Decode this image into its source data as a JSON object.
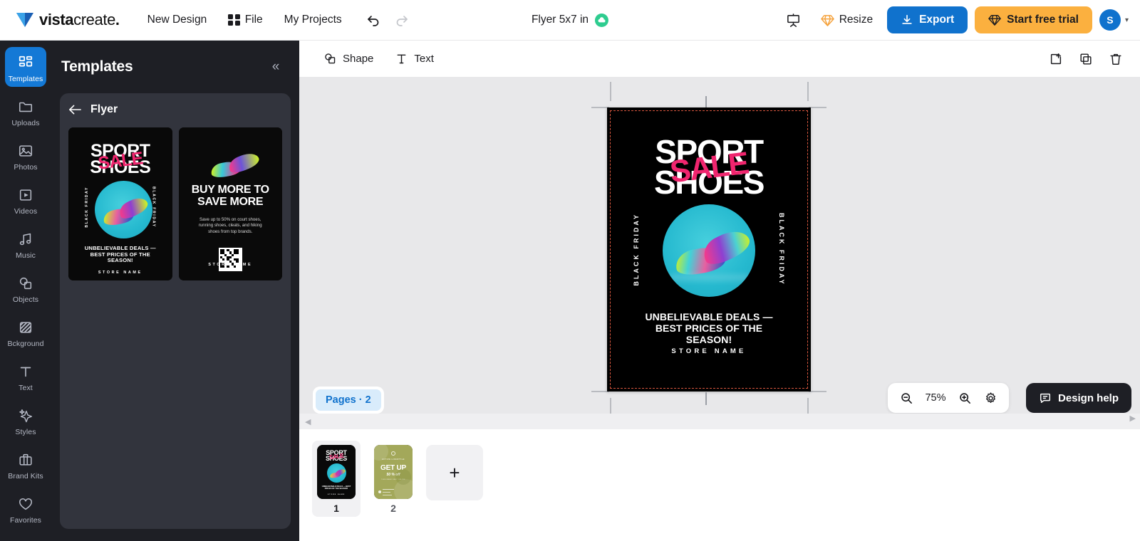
{
  "brand": {
    "logo_text_bold": "vista",
    "logo_text_thin": "create",
    "logo_dot": "."
  },
  "topbar": {
    "new_design": "New Design",
    "file": "File",
    "my_projects": "My Projects",
    "undo_icon": "undo-icon",
    "redo_icon": "redo-icon",
    "doc_title": "Flyer 5x7 in",
    "saved_icon": "cloud-saved-icon",
    "present_icon": "present-icon",
    "resize": "Resize",
    "resize_icon": "premium-diamond-icon",
    "export": "Export",
    "export_icon": "download-icon",
    "trial": "Start free trial",
    "trial_icon": "premium-diamond-icon",
    "avatar_initial": "S",
    "avatar_caret": "▾"
  },
  "rail": {
    "items": [
      {
        "label": "Templates",
        "icon": "templates-icon",
        "active": true
      },
      {
        "label": "Uploads",
        "icon": "folder-icon",
        "active": false
      },
      {
        "label": "Photos",
        "icon": "photo-icon",
        "active": false
      },
      {
        "label": "Videos",
        "icon": "video-icon",
        "active": false
      },
      {
        "label": "Music",
        "icon": "music-icon",
        "active": false
      },
      {
        "label": "Objects",
        "icon": "objects-icon",
        "active": false
      },
      {
        "label": "Bckground",
        "icon": "background-icon",
        "active": false
      },
      {
        "label": "Text",
        "icon": "text-icon",
        "active": false
      },
      {
        "label": "Styles",
        "icon": "styles-icon",
        "active": false
      },
      {
        "label": "Brand Kits",
        "icon": "briefcase-icon",
        "active": false
      },
      {
        "label": "Favorites",
        "icon": "heart-icon",
        "active": false
      }
    ]
  },
  "panel": {
    "title": "Templates",
    "collapse_icon": "collapse-left-icon",
    "breadcrumb_back_icon": "arrow-left-icon",
    "breadcrumb_label": "Flyer",
    "templates": [
      {
        "name": "sport-shoes-sale-flyer",
        "title_line1": "SPORT",
        "title_line2": "SHOES",
        "overlay": "SALE",
        "side_left": "BLACK FRIDAY",
        "side_right": "BLACK FRIDAY",
        "deals": "UNBELIEVABLE DEALS — BEST PRICES OF THE SEASON!",
        "store": "STORE NAME"
      },
      {
        "name": "buy-more-to-save-more-flyer",
        "heading_line1": "BUY MORE TO",
        "heading_line2": "SAVE MORE",
        "body": "Save up to 50% on court shoes, running shoes, cleats, and hiking shoes from top brands.",
        "store": "STORE NAME",
        "qr": "qr-code-icon"
      }
    ]
  },
  "canvas_toolbar": {
    "shape": "Shape",
    "shape_icon": "shape-icon",
    "text": "Text",
    "text_icon": "text-t-icon",
    "add_page_icon": "add-page-icon",
    "duplicate_icon": "duplicate-icon",
    "delete_icon": "trash-icon"
  },
  "artboard": {
    "title_line1": "SPORT",
    "title_line2": "SHOES",
    "overlay": "SALE",
    "side_left": "BLACK FRIDAY",
    "side_right": "BLACK FRIDAY",
    "deals_line1": "UNBELIEVABLE DEALS —",
    "deals_line2": "BEST PRICES OF THE",
    "deals_line3": "SEASON!",
    "store": "STORE NAME",
    "bg_color": "#000000",
    "accent_color": "#f0256e",
    "circle_color": "#2bbdd2",
    "selection_color": "#d8563d"
  },
  "stage": {
    "pages_chip": "Pages · 2",
    "zoom_out_icon": "zoom-out-icon",
    "zoom_value": "75%",
    "zoom_in_icon": "zoom-in-icon",
    "settings_icon": "gear-icon",
    "design_help": "Design help",
    "design_help_icon": "chat-icon"
  },
  "strip": {
    "scroll_left_icon": "scroll-left-icon",
    "scroll_right_icon": "scroll-right-icon",
    "drag_handle_icon": "drag-dots-icon",
    "pages": [
      {
        "num": "1",
        "selected": true,
        "kind": "sport-shoes",
        "title1": "SPORT",
        "title2": "SHOES",
        "overlay": "SALE",
        "store": "STORE NAME"
      },
      {
        "num": "2",
        "selected": false,
        "kind": "get-up-olive",
        "heading": "GET UP",
        "sub": "50 % off"
      }
    ],
    "add_page_label": "+"
  },
  "colors": {
    "accent_blue": "#1072cd",
    "trial_orange": "#fbb03f",
    "panel_dark": "#1e1f25",
    "panel_card": "#32343d",
    "stage_gray": "#e8e8ea"
  }
}
